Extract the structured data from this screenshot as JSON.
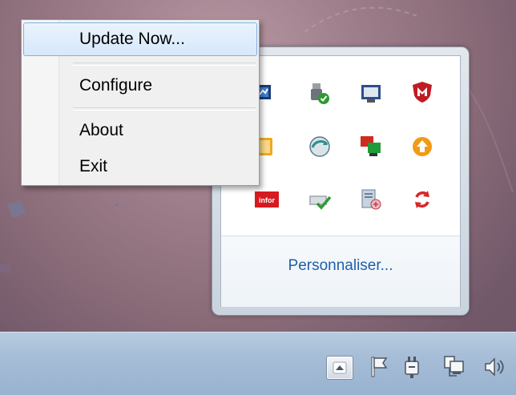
{
  "context_menu": {
    "items": [
      {
        "label": "Update Now...",
        "highlighted": true
      },
      {
        "label": "Configure"
      },
      {
        "label": "About"
      },
      {
        "label": "Exit"
      }
    ]
  },
  "tray_overflow": {
    "icons": [
      "network-monitor-icon",
      "usb-device-ok-icon",
      "display-icon",
      "mcafee-shield-icon",
      "orange-app-icon",
      "sync-globe-icon",
      "remote-screens-icon",
      "update-arrow-icon",
      "infor-icon",
      "network-check-icon",
      "document-tool-icon",
      "refresh-arrows-icon"
    ],
    "customize_label": "Personnaliser..."
  },
  "taskbar": {
    "icons": [
      "show-hidden-icons-icon",
      "action-center-flag-icon",
      "power-plug-icon",
      "network-icon",
      "volume-icon"
    ]
  }
}
